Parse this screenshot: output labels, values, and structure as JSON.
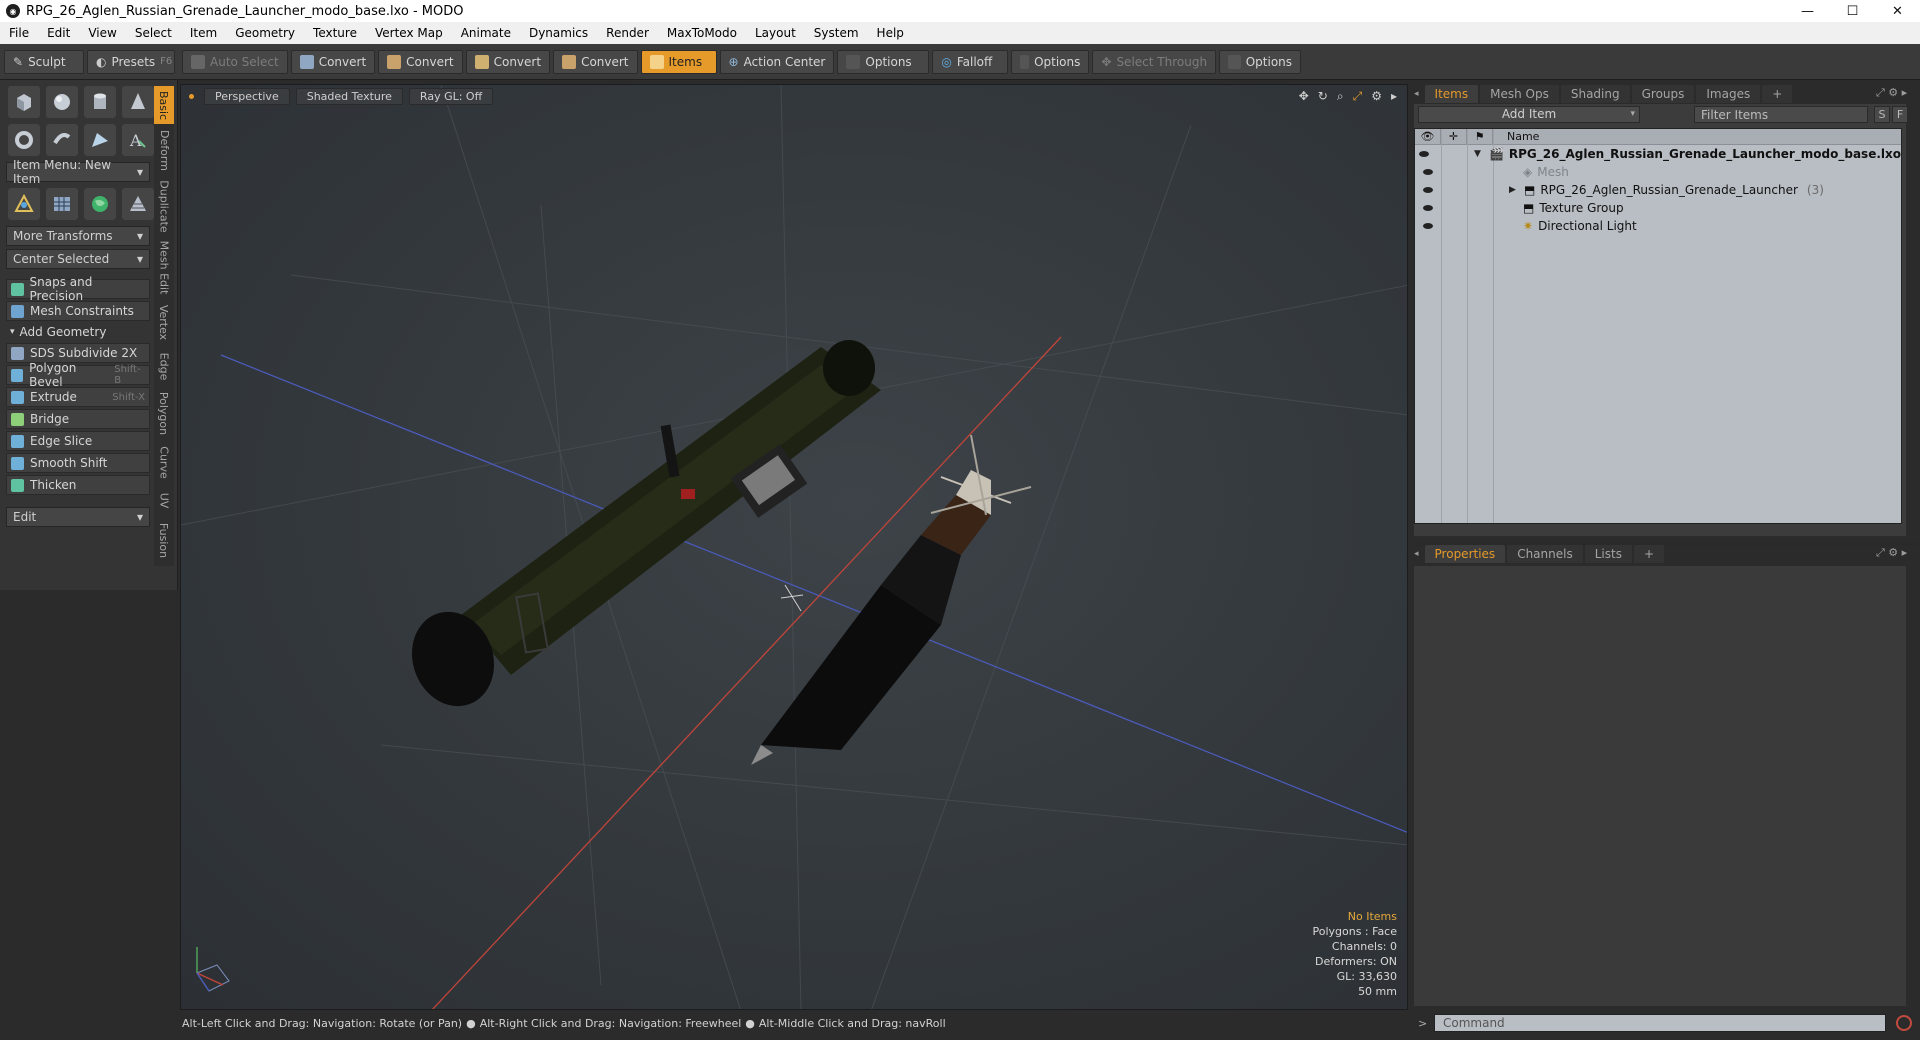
{
  "window": {
    "title": "RPG_26_Aglen_Russian_Grenade_Launcher_modo_base.lxo - MODO",
    "controls": [
      "—",
      "☐",
      "✕"
    ]
  },
  "menu": [
    "File",
    "Edit",
    "View",
    "Select",
    "Item",
    "Geometry",
    "Texture",
    "Vertex Map",
    "Animate",
    "Dynamics",
    "Render",
    "MaxToModo",
    "Layout",
    "System",
    "Help"
  ],
  "toolbar": {
    "sculpt": "Sculpt",
    "presets": "Presets",
    "presets_shortcut": "F6",
    "auto_select": "Auto Select",
    "convert1": "Convert",
    "convert2": "Convert",
    "convert3": "Convert",
    "convert4": "Convert",
    "items": "Items",
    "action_center": "Action Center",
    "options1": "Options",
    "falloff": "Falloff",
    "options2": "Options",
    "select_through": "Select Through",
    "options3": "Options"
  },
  "left_panel": {
    "item_menu": "Item Menu: New Item",
    "more_transforms": "More Transforms",
    "center_selected": "Center Selected",
    "snaps": "Snaps and Precision",
    "mesh_constraints": "Mesh Constraints",
    "add_geometry": "Add Geometry",
    "tools": [
      {
        "label": "SDS Subdivide 2X",
        "shortcut": ""
      },
      {
        "label": "Polygon Bevel",
        "shortcut": "Shift-B"
      },
      {
        "label": "Extrude",
        "shortcut": "Shift-X"
      },
      {
        "label": "Bridge",
        "shortcut": ""
      },
      {
        "label": "Edge Slice",
        "shortcut": ""
      },
      {
        "label": "Smooth Shift",
        "shortcut": ""
      },
      {
        "label": "Thicken",
        "shortcut": ""
      }
    ],
    "edit": "Edit",
    "vertical_tabs": [
      "Basic",
      "Deform",
      "Duplicate",
      "Mesh Edit",
      "Vertex",
      "Edge",
      "Polygon",
      "Curve",
      "UV",
      "Fusion"
    ]
  },
  "viewport": {
    "perspective": "Perspective",
    "shading": "Shaded Texture",
    "raygl": "Ray GL: Off",
    "stats": {
      "selection": "No Items",
      "polygons": "Polygons : Face",
      "channels": "Channels: 0",
      "deformers": "Deformers: ON",
      "gl": "GL: 33,630",
      "lens": "50 mm"
    }
  },
  "status_bar": {
    "hint1": "Alt-Left Click and Drag: Navigation: Rotate (or Pan)",
    "hint2": "Alt-Right Click and Drag: Navigation: Freewheel",
    "hint3": "Alt-Middle Click and Drag: navRoll"
  },
  "items_panel": {
    "tabs": [
      "Items",
      "Mesh Ops",
      "Shading",
      "Groups",
      "Images",
      "+"
    ],
    "add_item": "Add Item",
    "filter_placeholder": "Filter Items",
    "s_btn": "S",
    "f_btn": "F",
    "name_header": "Name",
    "rows": [
      {
        "label": "RPG_26_Aglen_Russian_Grenade_Launcher_modo_base.lxo",
        "count": ""
      },
      {
        "label": "Mesh",
        "count": ""
      },
      {
        "label": "RPG_26_Aglen_Russian_Grenade_Launcher",
        "count": "(3)"
      },
      {
        "label": "Texture Group",
        "count": ""
      },
      {
        "label": "Directional Light",
        "count": ""
      }
    ]
  },
  "properties_panel": {
    "tabs": [
      "Properties",
      "Channels",
      "Lists",
      "+"
    ]
  },
  "command": {
    "placeholder": "Command",
    "prompt": ">"
  },
  "colors": {
    "accent": "#e59a2a",
    "x_axis": "#c0453a",
    "z_axis": "#4a5ab8"
  }
}
